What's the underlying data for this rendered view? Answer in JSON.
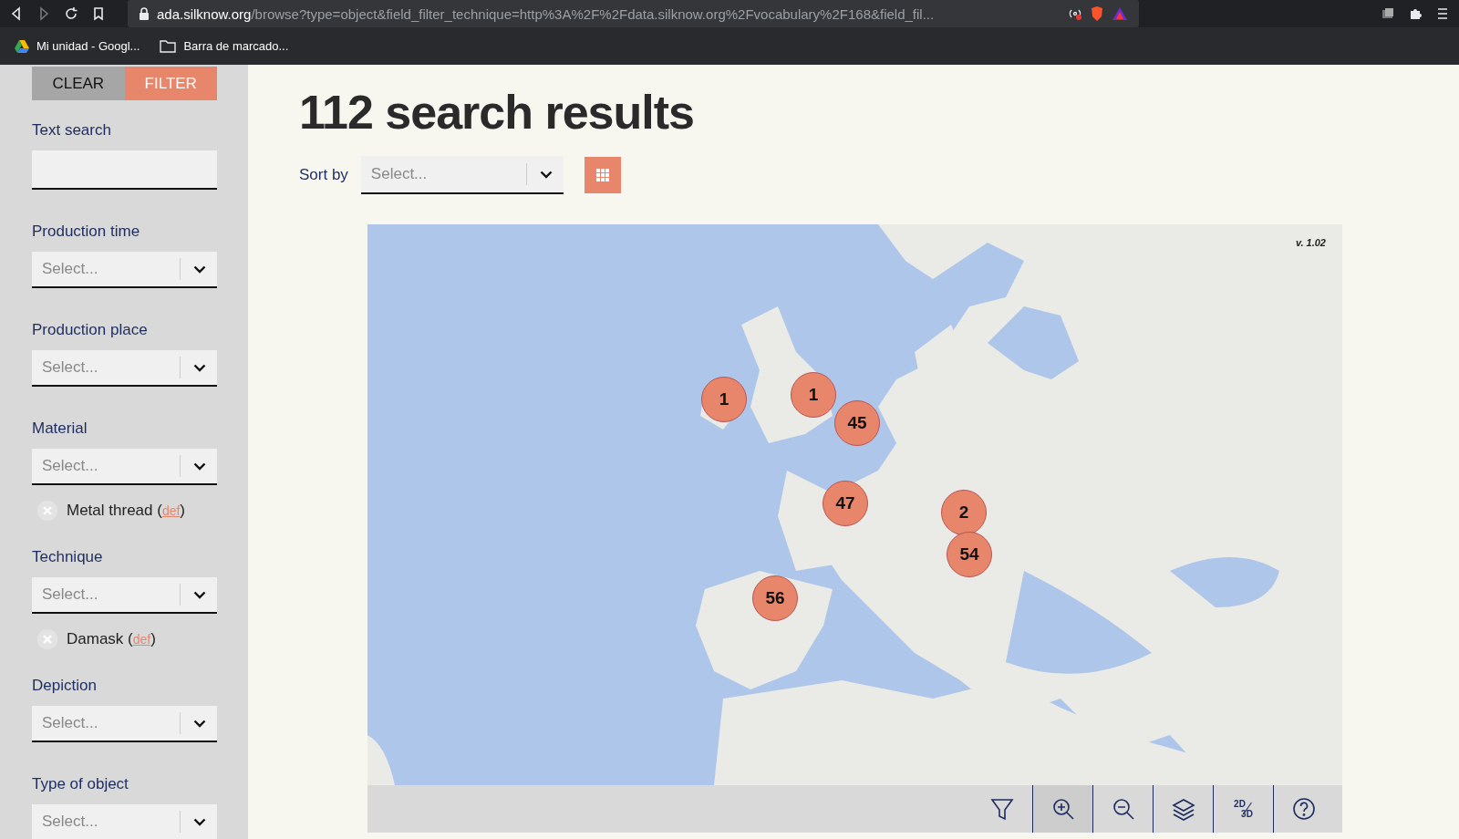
{
  "browser": {
    "url_host": "ada.silknow.org",
    "url_path": "/browse?type=object&field_filter_technique=http%3A%2F%2Fdata.silknow.org%2Fvocabulary%2F168&field_fil...",
    "bookmarks": [
      {
        "label": "Mi unidad - Googl...",
        "kind": "drive"
      },
      {
        "label": "Barra de marcado...",
        "kind": "folder"
      }
    ]
  },
  "sidebar": {
    "buttons": [
      {
        "label": "CLEAR",
        "kind": "clear"
      },
      {
        "label": "FILTER",
        "kind": "filter"
      }
    ],
    "filters": [
      {
        "label": "Text search",
        "kind": "text"
      },
      {
        "label": "Production time",
        "kind": "select",
        "placeholder": "Select..."
      },
      {
        "label": "Production place",
        "kind": "select",
        "placeholder": "Select..."
      },
      {
        "label": "Material",
        "kind": "select",
        "placeholder": "Select...",
        "tags": [
          {
            "label": "Metal thread (",
            "link": "def",
            "after": ")"
          }
        ]
      },
      {
        "label": "Technique",
        "kind": "select",
        "placeholder": "Select...",
        "tags": [
          {
            "label": "Damask (",
            "link": "def",
            "after": ")"
          }
        ]
      },
      {
        "label": "Depiction",
        "kind": "select",
        "placeholder": "Select..."
      },
      {
        "label": "Type of object",
        "kind": "select",
        "placeholder": "Select..."
      }
    ]
  },
  "main": {
    "title": "112 search results",
    "sort": {
      "label": "Sort by",
      "placeholder": "Select..."
    },
    "map": {
      "version": "v. 1.02",
      "clusters": [
        {
          "count": "1"
        },
        {
          "count": "1"
        },
        {
          "count": "45"
        },
        {
          "count": "47"
        },
        {
          "count": "2"
        },
        {
          "count": "54"
        },
        {
          "count": "56"
        }
      ],
      "toolbar": [
        {
          "kind": "filter",
          "selected": false
        },
        {
          "kind": "zoom-in",
          "selected": true
        },
        {
          "kind": "zoom-out",
          "selected": false
        },
        {
          "kind": "layers",
          "selected": false
        },
        {
          "kind": "dimension",
          "labels": [
            "2D",
            "3D"
          ],
          "selected": false
        },
        {
          "kind": "help",
          "selected": false
        }
      ]
    }
  }
}
